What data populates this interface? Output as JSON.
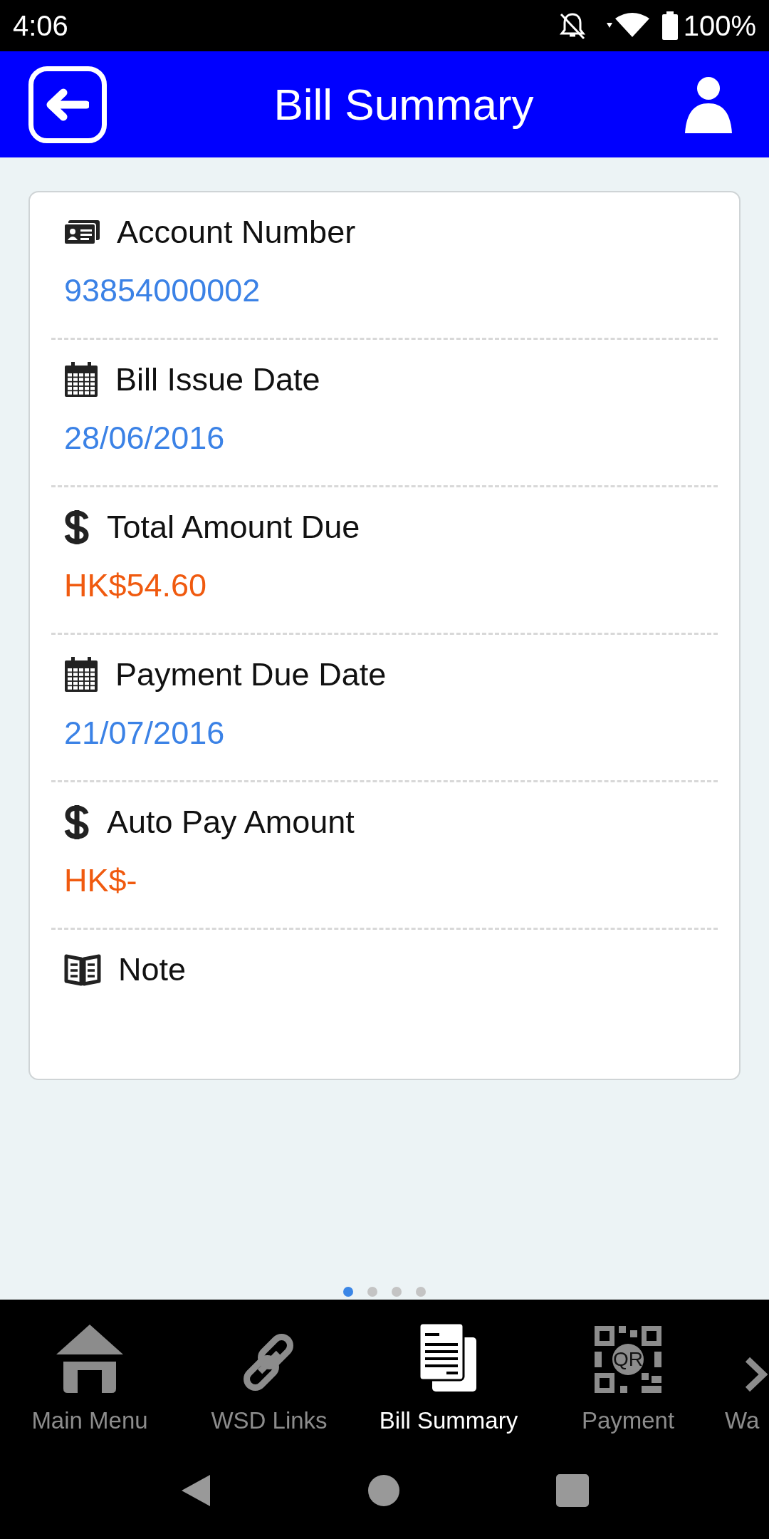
{
  "status_bar": {
    "time": "4:06",
    "battery": "100%"
  },
  "header": {
    "title": "Bill Summary"
  },
  "fields": [
    {
      "kind": "id-card",
      "label": "Account Number",
      "value": "93854000002",
      "color": "#3b82e6"
    },
    {
      "kind": "calendar",
      "label": "Bill Issue Date",
      "value": "28/06/2016",
      "color": "#3b82e6"
    },
    {
      "kind": "dollar",
      "label": "Total Amount Due",
      "value": "HK$54.60",
      "color": "#f05a0f"
    },
    {
      "kind": "calendar",
      "label": "Payment Due Date",
      "value": "21/07/2016",
      "color": "#3b82e6"
    },
    {
      "kind": "dollar",
      "label": "Auto Pay Amount",
      "value": "HK$-",
      "color": "#f05a0f"
    },
    {
      "kind": "book",
      "label": "Note"
    }
  ],
  "page_dots": [
    {
      "selected": true
    },
    {
      "selected": false
    },
    {
      "selected": false
    },
    {
      "selected": false
    }
  ],
  "nav": [
    {
      "kind": "home",
      "label": "Main Menu",
      "selected": false
    },
    {
      "kind": "link",
      "label": "WSD Links",
      "selected": false
    },
    {
      "kind": "bill",
      "label": "Bill Summary",
      "selected": true
    },
    {
      "kind": "qr",
      "label": "Payment",
      "icon_text": "QR",
      "selected": false
    },
    {
      "kind": "partial",
      "label": "Wa",
      "selected": false
    }
  ]
}
